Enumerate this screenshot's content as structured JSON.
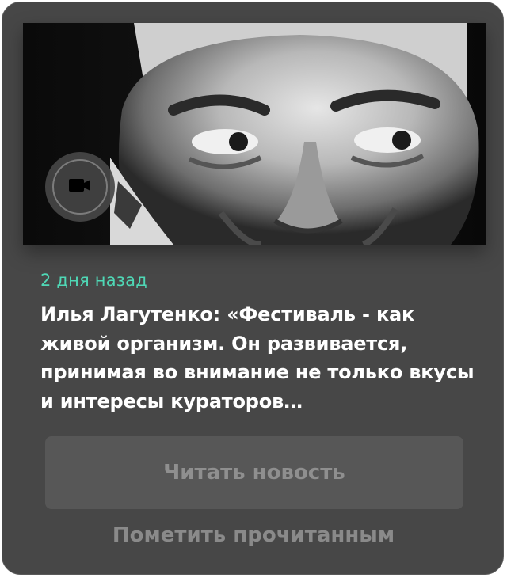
{
  "card": {
    "media": {
      "image_icon": "portrait-photo",
      "badge_icon": "video-camera-icon"
    },
    "time_label": "2 дня назад",
    "headline": "Илья Лагутенко: «Фестиваль - как живой организм. Он развивается, принимая во внимание не только вкусы и интересы кураторов…",
    "read_button_label": "Читать новость",
    "mark_read_label": "Пометить прочитанным"
  },
  "colors": {
    "card_background": "#474747",
    "accent_time": "#4fd8b6",
    "headline_text": "#ffffff",
    "button_background": "#575757",
    "button_text": "#8f8f8f"
  }
}
